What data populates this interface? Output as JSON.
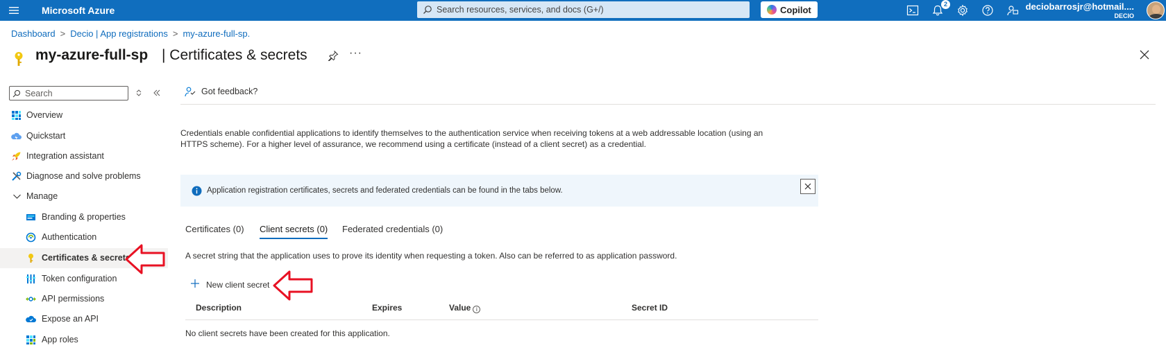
{
  "topbar": {
    "brand": "Microsoft Azure",
    "search_placeholder": "Search resources, services, and docs (G+/)",
    "copilot_label": "Copilot",
    "notification_count": "2",
    "account_email": "deciobarrosjr@hotmail....",
    "account_tenant": "DECIO"
  },
  "breadcrumb": {
    "items": [
      "Dashboard",
      "Decio | App registrations",
      "my-azure-full-sp."
    ]
  },
  "header": {
    "app_name": "my-azure-full-sp",
    "page_name": "| Certificates & secrets",
    "more_label": "···"
  },
  "sidebar": {
    "search_placeholder": "Search",
    "items": [
      {
        "label": "Overview",
        "icon": "overview-icon"
      },
      {
        "label": "Quickstart",
        "icon": "quickstart-icon"
      },
      {
        "label": "Integration assistant",
        "icon": "rocket-icon"
      },
      {
        "label": "Diagnose and solve problems",
        "icon": "wrench-icon"
      },
      {
        "label": "Manage",
        "icon": "chevron-down-icon"
      },
      {
        "label": "Branding & properties",
        "icon": "branding-icon"
      },
      {
        "label": "Authentication",
        "icon": "authentication-icon"
      },
      {
        "label": "Certificates & secrets",
        "icon": "key-icon",
        "active": true
      },
      {
        "label": "Token configuration",
        "icon": "token-icon"
      },
      {
        "label": "API permissions",
        "icon": "api-permissions-icon"
      },
      {
        "label": "Expose an API",
        "icon": "cloud-icon"
      },
      {
        "label": "App roles",
        "icon": "app-roles-icon"
      }
    ]
  },
  "main": {
    "feedback_label": "Got feedback?",
    "description": "Credentials enable confidential applications to identify themselves to the authentication service when receiving tokens at a web addressable location (using an HTTPS scheme). For a higher level of assurance, we recommend using a certificate (instead of a client secret) as a credential.",
    "info_banner": "Application registration certificates, secrets and federated credentials can be found in the tabs below.",
    "tabs": [
      {
        "label": "Certificates (0)"
      },
      {
        "label": "Client secrets (0)",
        "selected": true
      },
      {
        "label": "Federated credentials (0)"
      }
    ],
    "secret_description": "A secret string that the application uses to prove its identity when requesting a token. Also can be referred to as application password.",
    "new_secret_label": "New client secret",
    "table": {
      "columns": [
        "Description",
        "Expires",
        "Value",
        "Secret ID"
      ],
      "empty_message": "No client secrets have been created for this application."
    }
  },
  "colors": {
    "brand_blue": "#106ebe",
    "link_blue": "#0f6cbd",
    "annotation_red": "#e81123"
  }
}
